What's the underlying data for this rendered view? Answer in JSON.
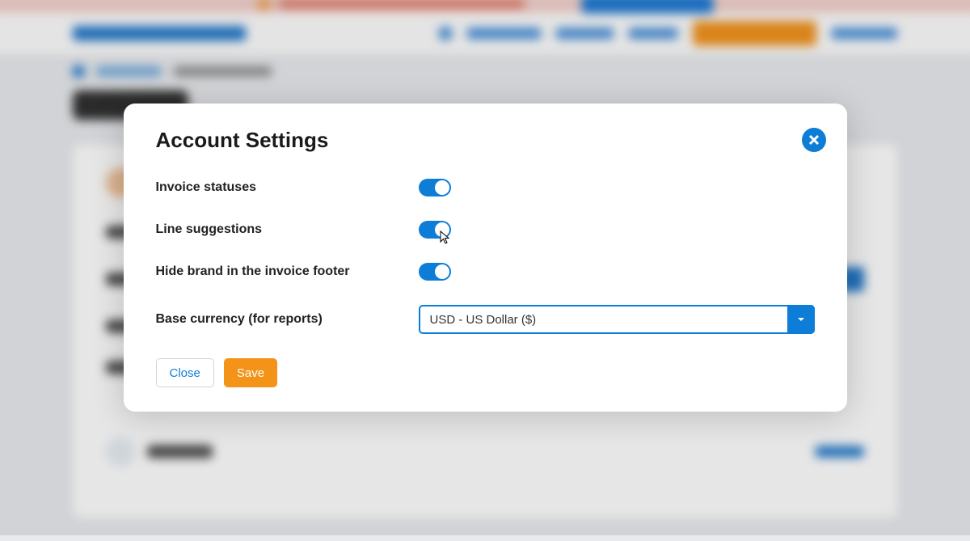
{
  "modal": {
    "title": "Account Settings",
    "settings": {
      "invoice_statuses": {
        "label": "Invoice statuses",
        "value": true
      },
      "line_suggestions": {
        "label": "Line suggestions",
        "value": true
      },
      "hide_brand": {
        "label": "Hide brand in the invoice footer",
        "value": true
      },
      "base_currency": {
        "label": "Base currency (for reports)",
        "selected": "USD - US Dollar ($)"
      }
    },
    "buttons": {
      "close": "Close",
      "save": "Save"
    }
  }
}
